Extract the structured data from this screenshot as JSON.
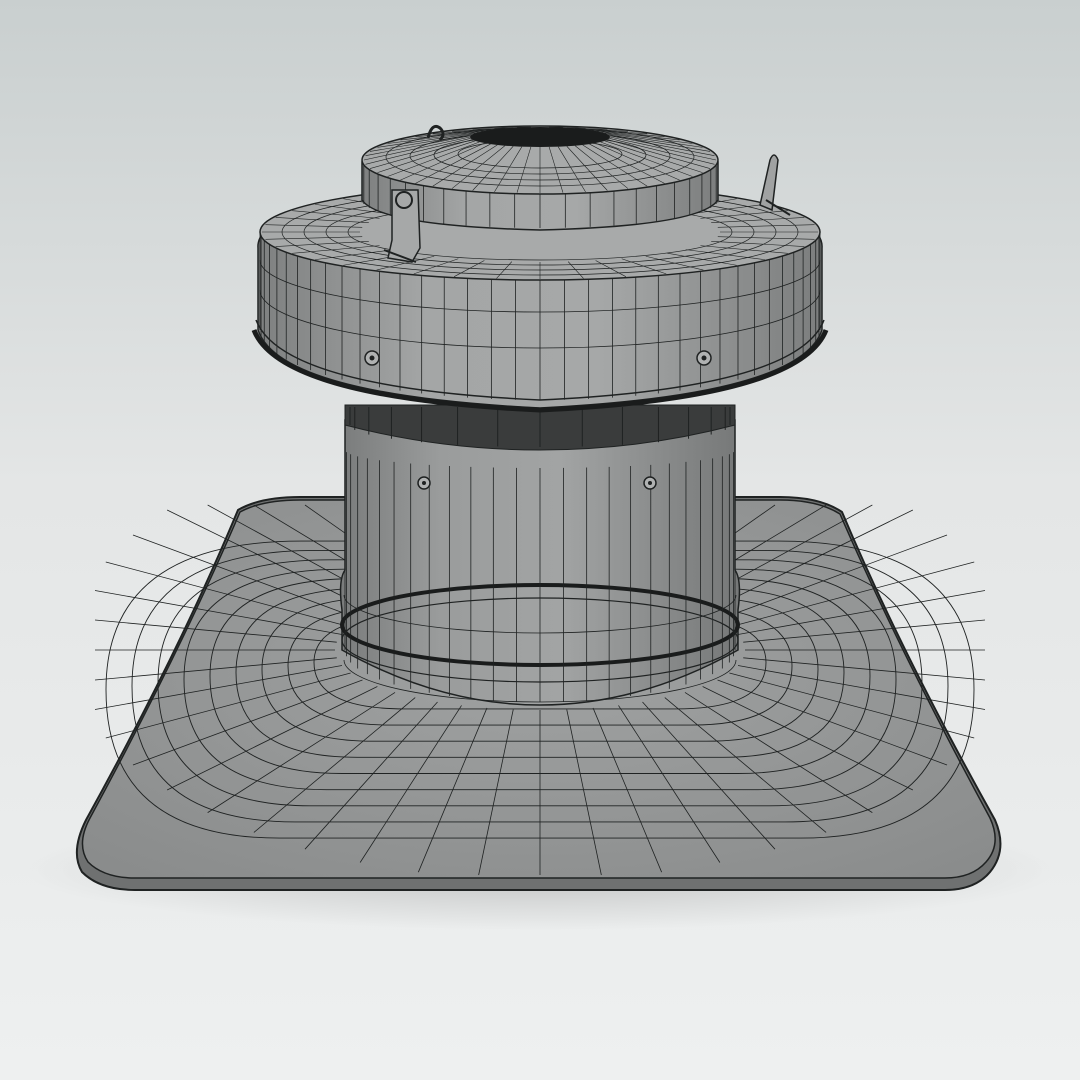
{
  "scene": {
    "subject": "roof-fan-wireframe-render",
    "colors": {
      "background_top": "#c9cfcf",
      "background_mid": "#e6e8e8",
      "background_bottom": "#eef0f0",
      "surface": "#8f9191",
      "surface_light": "#a3a5a5",
      "surface_dark": "#6d6f6f",
      "wire": "#1f2222",
      "opening": "#1a1c1c"
    },
    "icons": [
      "lifting-eye-icon",
      "vent-lever-icon",
      "bolt-icon"
    ]
  }
}
